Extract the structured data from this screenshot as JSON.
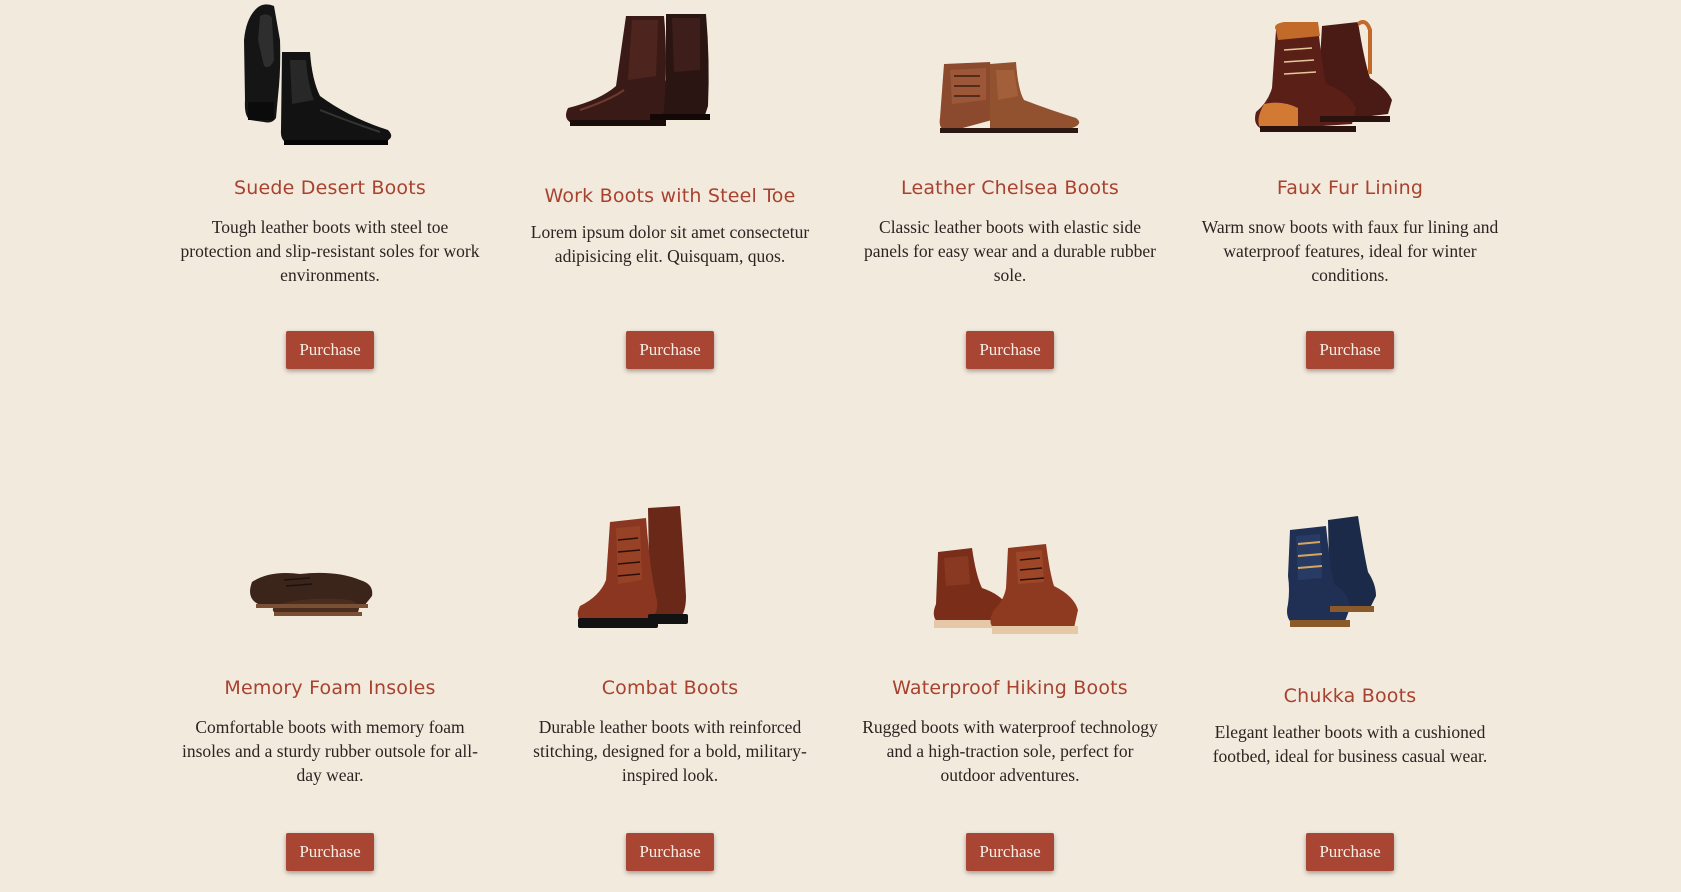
{
  "colors": {
    "background": "#f2eadd",
    "accent": "#a8422f",
    "button": "#a84533",
    "button_text": "#f5ece4",
    "body_text": "#2b2421"
  },
  "products": [
    {
      "title": "Suede Desert Boots",
      "description": "Tough leather boots with steel toe protection and slip-resistant soles for work environments.",
      "button": "Purchase",
      "image": "black-chelsea-boot-image"
    },
    {
      "title": "Work Boots with Steel Toe",
      "description": "Lorem ipsum dolor sit amet consectetur adipisicing elit. Quisquam, quos.",
      "button": "Purchase",
      "image": "dark-brown-zip-boot-image"
    },
    {
      "title": "Leather Chelsea Boots",
      "description": "Classic leather boots with elastic side panels for easy wear and a durable rubber sole.",
      "button": "Purchase",
      "image": "brown-lace-up-boot-image"
    },
    {
      "title": "Faux Fur Lining",
      "description": "Warm snow boots with faux fur lining and waterproof features, ideal for winter conditions.",
      "button": "Purchase",
      "image": "two-tone-work-boot-image"
    },
    {
      "title": "Memory Foam Insoles",
      "description": "Comfortable boots with memory foam insoles and a sturdy rubber outsole for all-day wear.",
      "button": "Purchase",
      "image": "suede-derby-shoe-image"
    },
    {
      "title": "Combat Boots",
      "description": "Durable leather boots with reinforced stitching, designed for a bold, military-inspired look.",
      "button": "Purchase",
      "image": "brogue-combat-boot-image"
    },
    {
      "title": "Waterproof Hiking Boots",
      "description": "Rugged boots with waterproof technology and a high-traction sole, perfect for outdoor adventures.",
      "button": "Purchase",
      "image": "moc-toe-boot-image"
    },
    {
      "title": "Chukka Boots",
      "description": "Elegant leather boots with a cushioned footbed, ideal for business casual wear.",
      "button": "Purchase",
      "image": "navy-suede-boot-image"
    }
  ]
}
